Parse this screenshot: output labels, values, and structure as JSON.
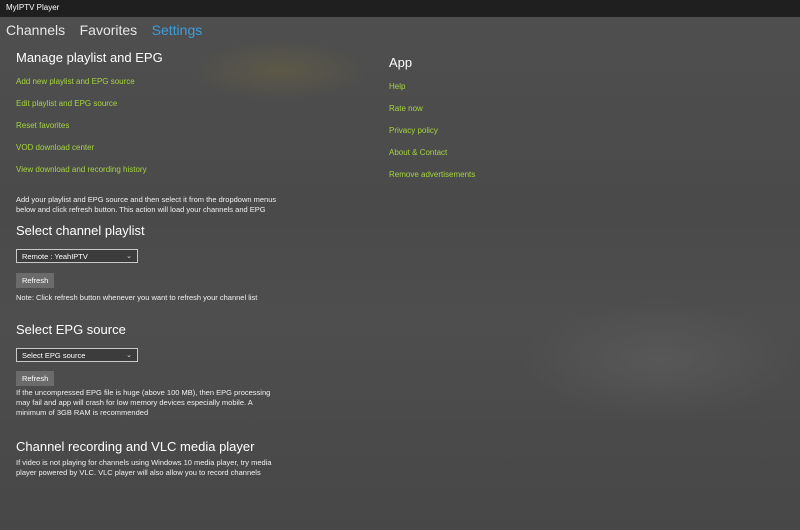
{
  "window": {
    "title": "MyIPTV Player"
  },
  "nav": {
    "tabs": [
      {
        "label": "Channels"
      },
      {
        "label": "Favorites"
      },
      {
        "label": "Settings"
      }
    ],
    "active_color": "#3a9fdc"
  },
  "manage": {
    "heading": "Manage playlist and EPG",
    "links": [
      "Add new playlist and EPG source",
      "Edit playlist and EPG source",
      "Reset favorites",
      "VOD download center",
      "View download and recording history"
    ],
    "description": "Add your playlist and EPG source and then select it from the dropdown menus below and click refresh button. This action will load your channels and EPG"
  },
  "channel_playlist": {
    "heading": "Select channel playlist",
    "selected": "Remote : YeahIPTV",
    "refresh_label": "Refresh",
    "note": "Note: Click refresh button whenever you want to refresh your channel list"
  },
  "epg_source": {
    "heading": "Select EPG source",
    "selected": "Select EPG source",
    "refresh_label": "Refresh",
    "note": "If the uncompressed EPG file is huge (above 100 MB), then EPG processing may fail and app will crash for low memory devices especially mobile. A minimum of 3GB RAM is recommended"
  },
  "recording": {
    "heading": "Channel recording and VLC media player",
    "description": "If video is not playing for channels using Windows 10 media player, try media player powered by VLC. VLC player will also allow you to record channels"
  },
  "app": {
    "heading": "App",
    "links": [
      "Help",
      "Rate now",
      "Privacy policy",
      "About & Contact",
      "Remove advertisements"
    ]
  },
  "colors": {
    "link": "#a6d23f",
    "titlebar": "#1f1f1f",
    "background": "#4d4d4d"
  }
}
